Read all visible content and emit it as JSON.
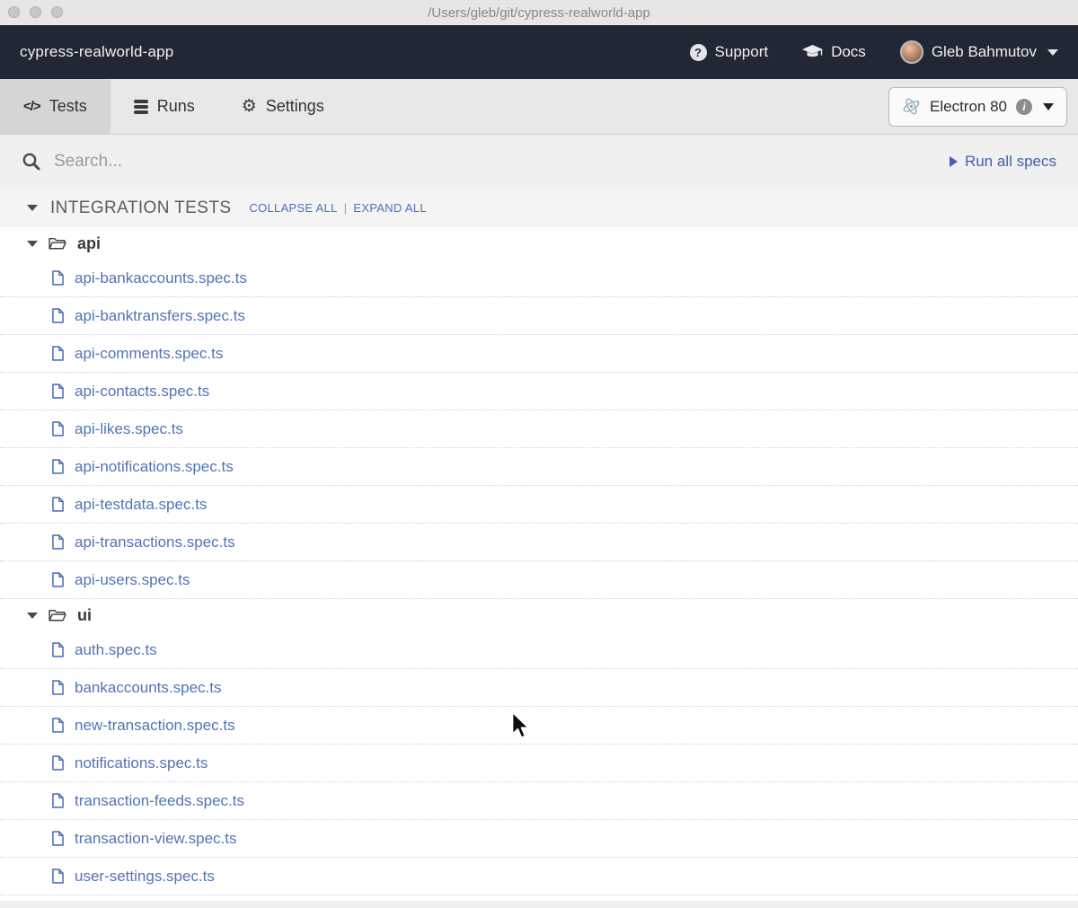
{
  "window": {
    "title": "/Users/gleb/git/cypress-realworld-app"
  },
  "navbar": {
    "project_name": "cypress-realworld-app",
    "support": {
      "icon_glyph": "?",
      "label": "Support"
    },
    "docs": {
      "label": "Docs"
    },
    "user": {
      "name": "Gleb Bahmutov"
    }
  },
  "tabbar": {
    "tests_icon_glyph": "</>",
    "tests_label": "Tests",
    "runs_label": "Runs",
    "settings_icon_glyph": "⚙",
    "settings_label": "Settings",
    "browser": {
      "label": "Electron 80",
      "info_glyph": "i"
    }
  },
  "search": {
    "placeholder": "Search...",
    "run_all_label": "Run all specs"
  },
  "spec_list": {
    "header": {
      "title": "INTEGRATION TESTS",
      "collapse_all_label": "COLLAPSE ALL",
      "links_separator": "|",
      "expand_all_label": "EXPAND ALL"
    },
    "folders": [
      {
        "name": "api",
        "files": [
          "api-bankaccounts.spec.ts",
          "api-banktransfers.spec.ts",
          "api-comments.spec.ts",
          "api-contacts.spec.ts",
          "api-likes.spec.ts",
          "api-notifications.spec.ts",
          "api-testdata.spec.ts",
          "api-transactions.spec.ts",
          "api-users.spec.ts"
        ]
      },
      {
        "name": "ui",
        "files": [
          "auth.spec.ts",
          "bankaccounts.spec.ts",
          "new-transaction.spec.ts",
          "notifications.spec.ts",
          "transaction-feeds.spec.ts",
          "transaction-view.spec.ts",
          "user-settings.spec.ts"
        ]
      }
    ]
  },
  "colors": {
    "navbar_bg": "#222736",
    "spec_link_blue": "#5273b8",
    "small_link_blue": "#4a6fc3",
    "run_all_blue": "#4361ae",
    "active_tab_bg": "#d6d4d5"
  }
}
